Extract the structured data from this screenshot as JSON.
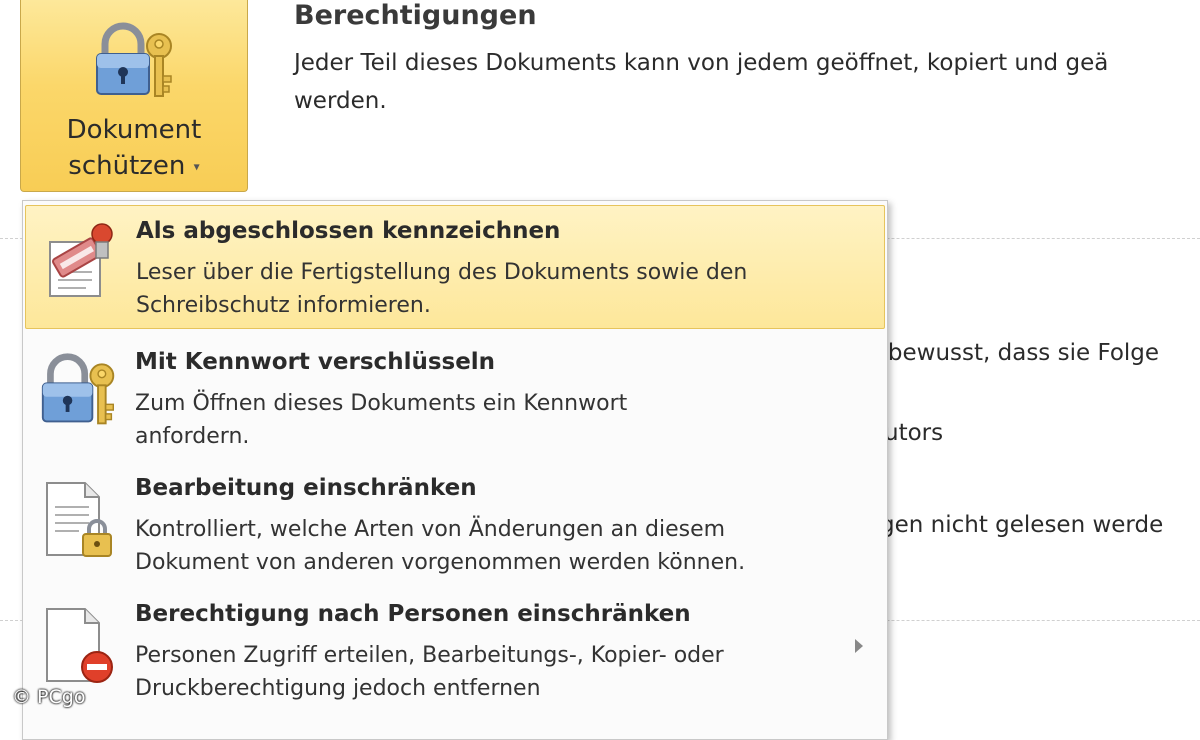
{
  "ribbon_button": {
    "label_line1": "Dokument",
    "label_line2": "schützen",
    "caret": "▾",
    "icon": "lock-key-icon"
  },
  "permissions": {
    "title": "Berechtigungen",
    "desc_line1": "Jeder Teil dieses Dokuments kann von jedem geöffnet, kopiert und geä",
    "desc_line2": "werden."
  },
  "background": {
    "text1": "h bewusst, dass sie Folge",
    "text2": "utors",
    "text3": "gen nicht gelesen werde"
  },
  "menu": {
    "items": [
      {
        "title": "Als abgeschlossen kennzeichnen",
        "desc_line1": "Leser über die Fertigstellung des Dokuments sowie den",
        "desc_line2": "Schreibschutz informieren.",
        "icon": "mark-final-icon"
      },
      {
        "title": "Mit Kennwort verschlüsseln",
        "desc_line1": "Zum Öffnen dieses Dokuments ein Kennwort",
        "desc_line2": "anfordern.",
        "icon": "lock-key-icon"
      },
      {
        "title": "Bearbeitung einschränken",
        "desc_line1": "Kontrolliert, welche Arten von Änderungen an diesem",
        "desc_line2": "Dokument von anderen vorgenommen werden können.",
        "icon": "document-lock-icon"
      },
      {
        "title": "Berechtigung nach Personen einschränken",
        "desc_line1": "Personen Zugriff erteilen, Bearbeitungs-, Kopier- oder",
        "desc_line2": "Druckberechtigung jedoch entfernen",
        "icon": "document-restrict-icon"
      }
    ]
  },
  "watermark": "© PCgo",
  "colors": {
    "button_fill": "#fbd76a",
    "hover_fill": "#fde79a",
    "restrict_red": "#e0402a"
  }
}
